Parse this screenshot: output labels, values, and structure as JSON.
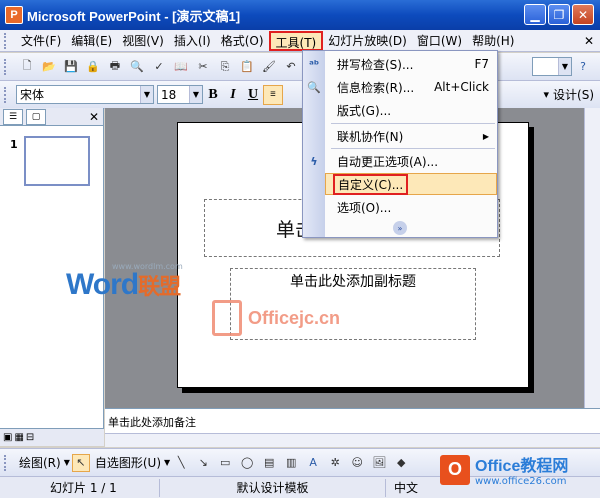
{
  "window": {
    "title": "Microsoft PowerPoint - [演示文稿1]",
    "minimize": "▁",
    "restore": "❐",
    "close": "✕"
  },
  "menubar": {
    "items": [
      "文件(F)",
      "编辑(E)",
      "视图(V)",
      "插入(I)",
      "格式(O)",
      "工具(T)",
      "幻灯片放映(D)",
      "窗口(W)",
      "帮助(H)"
    ],
    "close": "✕"
  },
  "toolbar2": {
    "font": "宋体",
    "size": "18",
    "bold": "B",
    "italic": "I",
    "underline": "U",
    "design": "设计(S)"
  },
  "tools_menu": {
    "items": [
      {
        "label": "拼写检查(S)...",
        "shortcut": "F7"
      },
      {
        "label": "信息检索(R)...",
        "shortcut": "Alt+Click"
      },
      {
        "label": "版式(G)...",
        "shortcut": ""
      },
      {
        "label": "联机协作(N)",
        "shortcut": "▶"
      },
      {
        "label": "自动更正选项(A)...",
        "shortcut": ""
      },
      {
        "label": "自定义(C)...",
        "shortcut": ""
      },
      {
        "label": "选项(O)...",
        "shortcut": ""
      }
    ],
    "expand": "»"
  },
  "slide": {
    "title_placeholder": "单击此处添加标题",
    "subtitle_placeholder": "单击此处添加副标题"
  },
  "thumbnail": {
    "number": "1"
  },
  "notes": {
    "placeholder": "单击此处添加备注"
  },
  "drawbar": {
    "draw": "绘图(R)",
    "autoshapes": "自选图形(U)"
  },
  "statusbar": {
    "slide": "幻灯片 1 / 1",
    "template": "默认设计模板",
    "language": "中文"
  },
  "watermarks": {
    "word": "Word",
    "word_cn": "联盟",
    "word_url": "www.wordlm.com",
    "officejc": "Officejc.cn",
    "office26_title": "Office教程网",
    "office26_url": "www.office26.com"
  }
}
